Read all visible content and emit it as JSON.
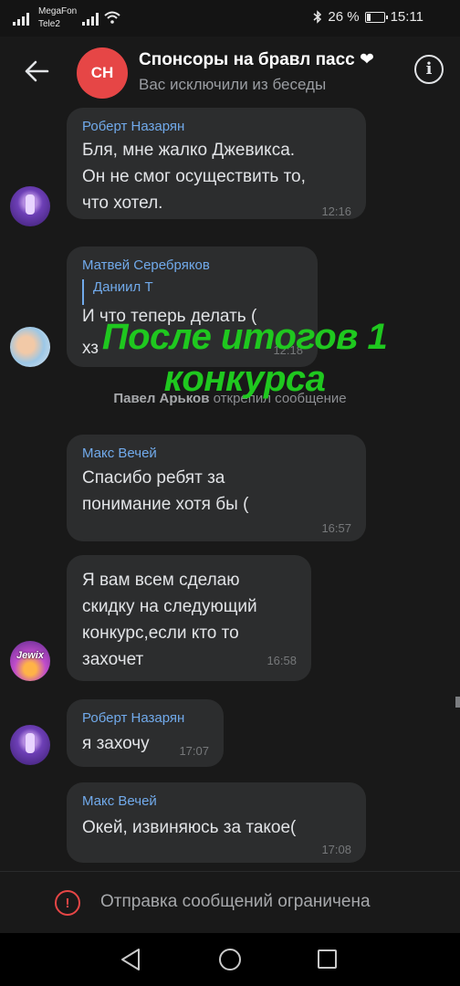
{
  "status_bar": {
    "carrier_1": "MegaFon",
    "carrier_2": "Tele2",
    "battery_percent": "26 %",
    "battery_level": 0.26,
    "time": "15:11",
    "icons": [
      "signal-icon",
      "wifi-icon",
      "bluetooth-icon",
      "battery-icon"
    ]
  },
  "header": {
    "back_icon": "arrow-left-icon",
    "avatar_initials": "СН",
    "avatar_color": "#e64646",
    "title": "Спонсоры на бравл пасс ❤",
    "subtitle": "Вас исключили из беседы",
    "info_icon": "info-icon",
    "info_glyph": "i"
  },
  "messages": [
    {
      "author": "Роберт Назарян",
      "lines": [
        "Бля, мне жалко Джевикса.",
        "Он не смог осуществить то,",
        "что хотел."
      ],
      "time": "12:16"
    },
    {
      "author": "Матвей Серебряков",
      "reply_to": "Даниил Т",
      "lines": [
        "И что теперь делать (",
        "хз"
      ],
      "time": "12:18"
    },
    {
      "author": "Макс Вечей",
      "lines": [
        "Спасибо ребят за",
        "понимание хотя бы ("
      ],
      "time": "16:57"
    },
    {
      "author": "",
      "lines": [
        "Я вам всем сделаю",
        "скидку на следующий",
        "конкурс,если кто то",
        "захочет"
      ],
      "time": "16:58"
    },
    {
      "author": "Роберт Назарян",
      "lines": [
        "я захочу"
      ],
      "time": "17:07"
    },
    {
      "author": "Макс Вечей",
      "lines": [
        "Окей, извиняюсь за такое("
      ],
      "time": "17:08"
    }
  ],
  "service_message": {
    "actor": "Павел Арьков",
    "action": "открепил сообщение"
  },
  "avatars": {
    "jewix_label": "Jewix"
  },
  "overlay": {
    "line_1": "После итогов 1",
    "line_2": "конкурса",
    "color": "#1fc81f"
  },
  "footer": {
    "restricted_icon": "warning-icon",
    "restricted_glyph": "!",
    "restricted_text": "Отправка сообщений ограничена"
  },
  "nav_bar": {
    "icons": [
      "nav-back-icon",
      "nav-home-icon",
      "nav-recent-icon"
    ]
  },
  "colors": {
    "background": "#191919",
    "bubble": "#2c2d2e",
    "author_name": "#71aaeb",
    "accent_red": "#e64646"
  }
}
